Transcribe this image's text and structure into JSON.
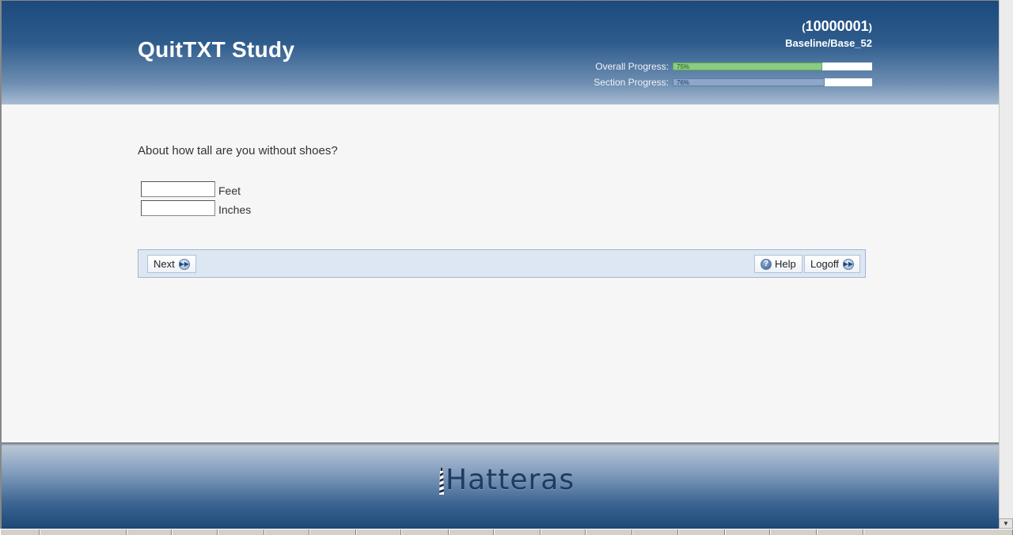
{
  "header": {
    "title": "QuitTXT Study",
    "user_id": "10000001",
    "section_path": "Baseline/Base_52",
    "overall_progress": {
      "label": "Overall Progress:",
      "value_text": "75%",
      "value": 75
    },
    "section_progress": {
      "label": "Section Progress:",
      "value_text": "76%",
      "value": 76
    }
  },
  "question": {
    "text": "About how tall are you without shoes?",
    "fields": [
      {
        "unit": "Feet",
        "value": ""
      },
      {
        "unit": "Inches",
        "value": ""
      }
    ]
  },
  "nav": {
    "next_label": "Next",
    "help_label": "Help",
    "logoff_label": "Logoff"
  },
  "footer": {
    "logo_text": "Hatteras"
  },
  "colors": {
    "header_dark": "#1d4a7c",
    "progress_green": "#8ccb84",
    "progress_blue": "#8ea7c8",
    "nav_bar": "#dde7f3"
  },
  "icons": {
    "next": "arrow-right-circle-icon",
    "help": "help-circle-icon",
    "logoff": "arrow-right-circle-icon",
    "logo": "lighthouse-icon"
  }
}
